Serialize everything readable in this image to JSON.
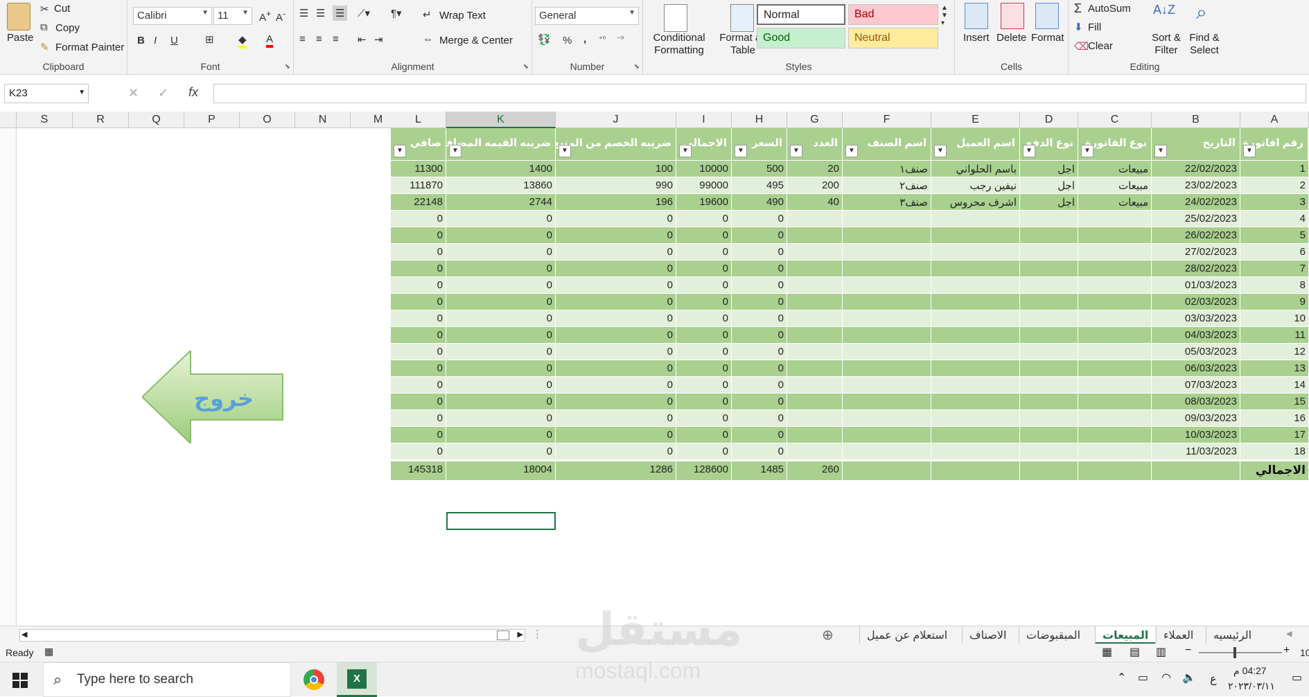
{
  "ribbon": {
    "clipboard": {
      "paste": "Paste",
      "cut": "Cut",
      "copy": "Copy",
      "format_painter": "Format Painter",
      "label": "Clipboard"
    },
    "font": {
      "name": "Calibri",
      "size": "11",
      "bold": "B",
      "italic": "I",
      "underline": "U",
      "label": "Font"
    },
    "alignment": {
      "wrap_text": "Wrap Text",
      "merge_center": "Merge & Center",
      "label": "Alignment"
    },
    "number": {
      "format": "General",
      "percent": "%",
      "comma": ",",
      "label": "Number"
    },
    "styles": {
      "conditional_formatting": "Conditional Formatting",
      "format_as_table": "Format as Table",
      "normal": "Normal",
      "bad": "Bad",
      "good": "Good",
      "neutral": "Neutral",
      "label": "Styles"
    },
    "cells": {
      "insert": "Insert",
      "delete": "Delete",
      "format": "Format",
      "label": "Cells"
    },
    "editing": {
      "autosum": "AutoSum",
      "fill": "Fill",
      "clear": "Clear",
      "sort_filter": "Sort & Filter",
      "find_select": "Find & Select",
      "label": "Editing"
    }
  },
  "formula_bar": {
    "name_box": "K23",
    "fx": "fx",
    "cancel": "✕",
    "enter": "✓",
    "value": ""
  },
  "columns": [
    "S",
    "R",
    "Q",
    "P",
    "O",
    "N",
    "M",
    "L",
    "K",
    "J",
    "I",
    "H",
    "G",
    "F",
    "E",
    "D",
    "C",
    "B",
    "A"
  ],
  "selected_column": "K",
  "table": {
    "headers": [
      "رقم افاتورة",
      "التاريخ",
      "نوع الفاتورة",
      "نوع الدفع",
      "اسم العميل",
      "اسم الصنف",
      "العدد",
      "السعر",
      "الاجمالي",
      "ضريبه الخصم من المنبع",
      "ضريبه القيمه المضافه",
      "صافي"
    ],
    "rows": [
      [
        "1",
        "22/02/2023",
        "مبيعات",
        "اجل",
        "باسم الحلواني",
        "صنف١",
        "20",
        "500",
        "10000",
        "100",
        "1400",
        "11300"
      ],
      [
        "2",
        "23/02/2023",
        "مبيعات",
        "اجل",
        "نيفين رجب",
        "صنف٢",
        "200",
        "495",
        "99000",
        "990",
        "13860",
        "111870"
      ],
      [
        "3",
        "24/02/2023",
        "مبيعات",
        "اجل",
        "اشرف محروس",
        "صنف٣",
        "40",
        "490",
        "19600",
        "196",
        "2744",
        "22148"
      ],
      [
        "4",
        "25/02/2023",
        "",
        "",
        "",
        "",
        "",
        "0",
        "0",
        "0",
        "0",
        "0"
      ],
      [
        "5",
        "26/02/2023",
        "",
        "",
        "",
        "",
        "",
        "0",
        "0",
        "0",
        "0",
        "0"
      ],
      [
        "6",
        "27/02/2023",
        "",
        "",
        "",
        "",
        "",
        "0",
        "0",
        "0",
        "0",
        "0"
      ],
      [
        "7",
        "28/02/2023",
        "",
        "",
        "",
        "",
        "",
        "0",
        "0",
        "0",
        "0",
        "0"
      ],
      [
        "8",
        "01/03/2023",
        "",
        "",
        "",
        "",
        "",
        "0",
        "0",
        "0",
        "0",
        "0"
      ],
      [
        "9",
        "02/03/2023",
        "",
        "",
        "",
        "",
        "",
        "0",
        "0",
        "0",
        "0",
        "0"
      ],
      [
        "10",
        "03/03/2023",
        "",
        "",
        "",
        "",
        "",
        "0",
        "0",
        "0",
        "0",
        "0"
      ],
      [
        "11",
        "04/03/2023",
        "",
        "",
        "",
        "",
        "",
        "0",
        "0",
        "0",
        "0",
        "0"
      ],
      [
        "12",
        "05/03/2023",
        "",
        "",
        "",
        "",
        "",
        "0",
        "0",
        "0",
        "0",
        "0"
      ],
      [
        "13",
        "06/03/2023",
        "",
        "",
        "",
        "",
        "",
        "0",
        "0",
        "0",
        "0",
        "0"
      ],
      [
        "14",
        "07/03/2023",
        "",
        "",
        "",
        "",
        "",
        "0",
        "0",
        "0",
        "0",
        "0"
      ],
      [
        "15",
        "08/03/2023",
        "",
        "",
        "",
        "",
        "",
        "0",
        "0",
        "0",
        "0",
        "0"
      ],
      [
        "16",
        "09/03/2023",
        "",
        "",
        "",
        "",
        "",
        "0",
        "0",
        "0",
        "0",
        "0"
      ],
      [
        "17",
        "10/03/2023",
        "",
        "",
        "",
        "",
        "",
        "0",
        "0",
        "0",
        "0",
        "0"
      ],
      [
        "18",
        "11/03/2023",
        "",
        "",
        "",
        "",
        "",
        "0",
        "0",
        "0",
        "0",
        "0"
      ]
    ],
    "total": {
      "label": "الاجمالي",
      "count": "260",
      "price": "1485",
      "total": "128600",
      "withholding": "1286",
      "vat": "18004",
      "net": "145318"
    }
  },
  "exit_button": "خروج",
  "sheet_tabs": [
    "الرئيسيه",
    "العملاء",
    "المبيعات",
    "المبقبوضات",
    "الاصناف",
    "استعلام عن عميل"
  ],
  "active_tab": "المبيعات",
  "status": {
    "ready": "Ready",
    "zoom": "10"
  },
  "taskbar": {
    "search_placeholder": "Type here to search",
    "time": "04:27 م",
    "date": "٢٠٢٣/٠٣/١١",
    "lang": "ع"
  },
  "watermark": {
    "main": "مستقل",
    "sub": "mostaql.com"
  },
  "colors": {
    "header_green": "#a9d08e",
    "row_light": "#e2efda",
    "accent": "#217346",
    "bad_fill": "#ffc7ce",
    "good_fill": "#c6efce",
    "neutral_fill": "#ffeb9c"
  }
}
